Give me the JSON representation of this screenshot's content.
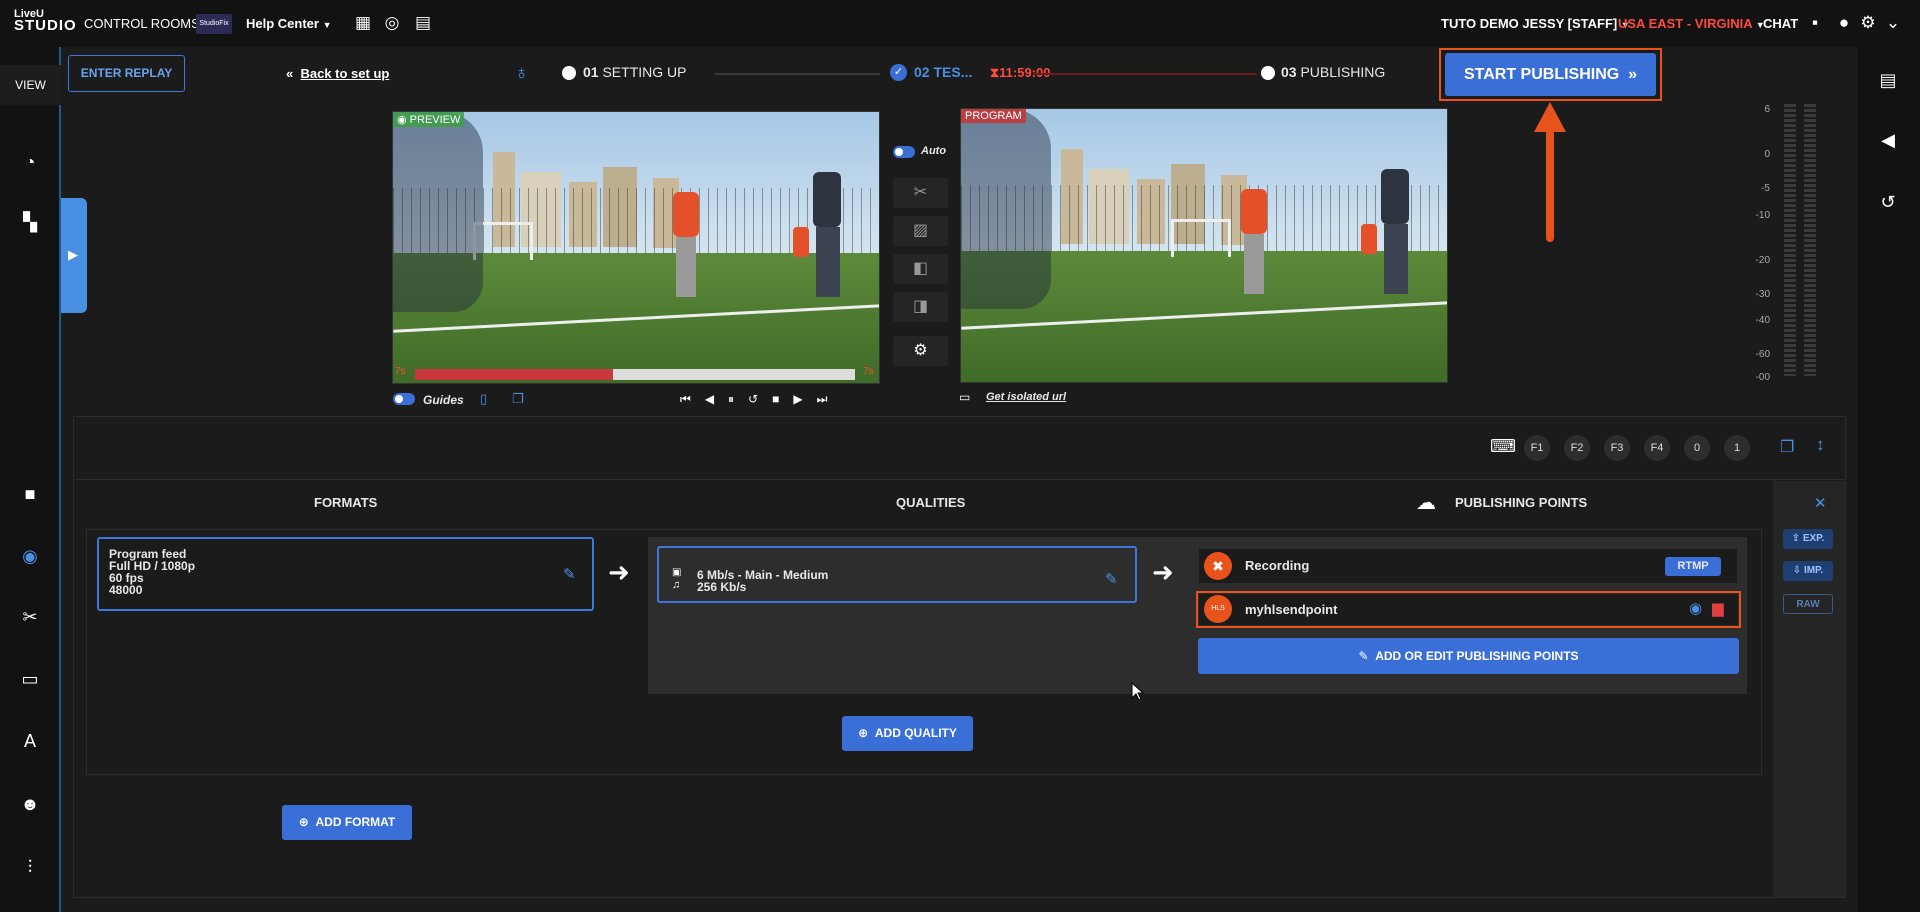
{
  "topbar": {
    "logo_line1": "LiveU",
    "logo_line2": "STUDIO",
    "control_rooms": "CONTROL ROOMS",
    "room_thumb": "StudioFix",
    "help_center": "Help Center",
    "user": "TUTO DEMO JESSY [STAFF]",
    "region": "USA EAST - VIRGINIA",
    "chat": "CHAT"
  },
  "sidebar": {
    "view_label": "VIEW"
  },
  "steps": {
    "enter_replay": "ENTER REPLAY",
    "back": "Back to set up",
    "step1_num": "01",
    "step1_label": "SETTING UP",
    "step2_num": "02",
    "step2_label": "TES...",
    "timer": "11:59:00",
    "step3_num": "03",
    "step3_label": "PUBLISHING",
    "start_publishing": "START PUBLISHING"
  },
  "preview": {
    "label": "PREVIEW",
    "guides": "Guides",
    "left_level": "7s",
    "right_level": "7s",
    "progress": 0.45
  },
  "switcher": {
    "auto": "Auto"
  },
  "program": {
    "label": "PROGRAM",
    "isolated_url": "Get isolated url"
  },
  "meter": {
    "ticks": [
      "6",
      "0",
      "-5",
      "-10",
      "-20",
      "-30",
      "-40",
      "-60",
      "-00"
    ]
  },
  "fkeys": [
    "F1",
    "F2",
    "F3",
    "F4",
    "0",
    "1"
  ],
  "columns": {
    "formats": "FORMATS",
    "qualities": "QUALITIES",
    "publishing_points": "PUBLISHING POINTS"
  },
  "format_card": {
    "line1": "Program feed",
    "line2": "Full HD / 1080p",
    "line3": "60 fps",
    "line4": "48000"
  },
  "quality_card": {
    "video": "6 Mb/s - Main - Medium",
    "audio": "256 Kb/s"
  },
  "publishing": {
    "rows": [
      {
        "name": "Recording",
        "badge": "RTMP"
      },
      {
        "name": "myhlsendpoint",
        "icon_text": "HLS"
      }
    ],
    "add_edit": "ADD OR EDIT PUBLISHING POINTS"
  },
  "buttons": {
    "add_quality": "ADD QUALITY",
    "add_format": "ADD FORMAT"
  },
  "side_actions": {
    "close": "✕",
    "exp": "EXP.",
    "imp": "IMP.",
    "raw": "RAW"
  },
  "colors": {
    "accent": "#3b6fd8",
    "highlight": "#e8531c",
    "region": "#ff4a3d"
  }
}
